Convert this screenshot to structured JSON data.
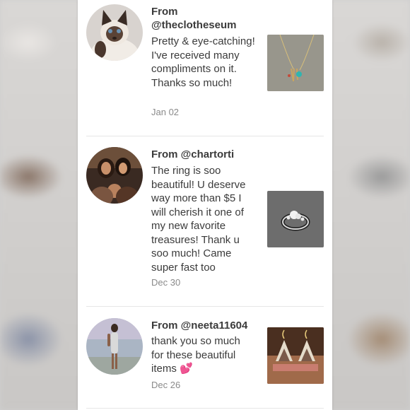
{
  "reviews": [
    {
      "from": "From @theclotheseum",
      "comment": "Pretty & eye-catching! I've received many compliments on it. Thanks so much!",
      "date": "Jan 02",
      "avatar_icon": "siamese-cat-avatar",
      "thumb_icon": "gold-necklace-thumbnail"
    },
    {
      "from": "From @chartorti",
      "comment": "The ring is soo beautiful! U deserve way more than $5 I will cherish it one of my new favorite treasures! Thank u soo much! Came super fast too",
      "date": "Dec 30",
      "avatar_icon": "group-photo-avatar",
      "thumb_icon": "silver-ring-thumbnail"
    },
    {
      "from": "From @neeta11604",
      "comment": "thank you so much for these beautiful items",
      "comment_emoji": "💕",
      "date": "Dec 26",
      "avatar_icon": "woman-dress-avatar",
      "thumb_icon": "earrings-thumbnail"
    }
  ]
}
